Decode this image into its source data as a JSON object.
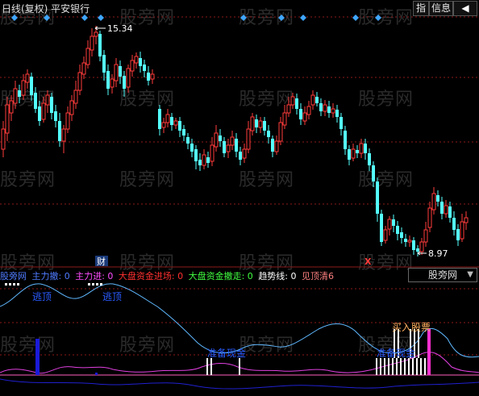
{
  "toolbar": {
    "title": "日线(复权)  平安银行",
    "btn_zhi": "指",
    "btn_info": "信息",
    "btn_arrow": "◀"
  },
  "price_panel": {
    "high_label": "15.34",
    "low_label": "8.97",
    "cai_marker": "财",
    "x_marker": "X"
  },
  "legend": {
    "name": "股旁网",
    "items": [
      {
        "text": "主力撤: 0",
        "color": "#4f7bff"
      },
      {
        "text": "主力进: 0",
        "color": "#ff4dff"
      },
      {
        "text": "大盘资金进场: 0",
        "color": "#ff3030"
      },
      {
        "text": "大盘资金撤走: 0",
        "color": "#40ff40"
      },
      {
        "text": "趋势线: 0",
        "color": "#ffffff"
      },
      {
        "text": "见顶清6",
        "color": "#ff8080"
      }
    ],
    "panel_selector": "股旁网"
  },
  "indicator_panel": {
    "label_ding1": "逃顶",
    "label_ding2": "逃顶",
    "label_zhunbei1": "准备现金",
    "label_zhunbei2": "准备现金",
    "label_mairu": "买入股票"
  },
  "watermark": "股旁网",
  "colors": {
    "up": "#ff3b3b",
    "down": "#54ffff",
    "grid": "#8b1a1a",
    "trend": "#5fb8ff",
    "osc": "#e040e0",
    "blue": "#2020d0"
  }
}
